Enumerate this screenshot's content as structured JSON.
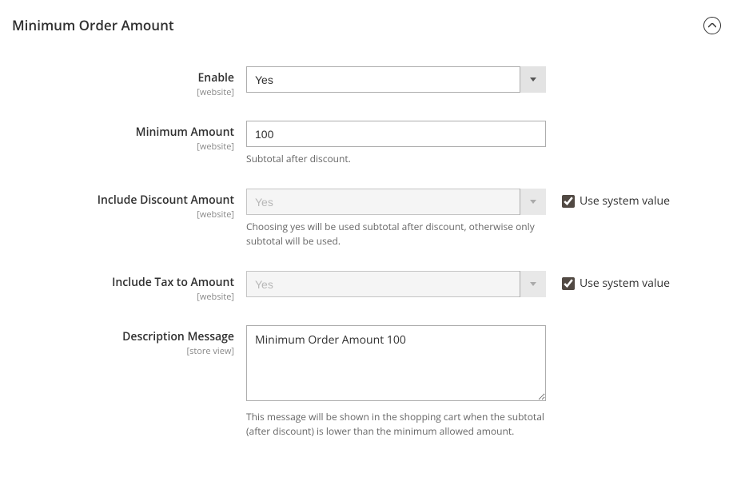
{
  "section": {
    "title": "Minimum Order Amount"
  },
  "fields": {
    "enable": {
      "label": "Enable",
      "scope": "[website]",
      "value": "Yes"
    },
    "minimum_amount": {
      "label": "Minimum Amount",
      "scope": "[website]",
      "value": "100",
      "help": "Subtotal after discount."
    },
    "include_discount": {
      "label": "Include Discount Amount",
      "scope": "[website]",
      "value": "Yes",
      "help": "Choosing yes will be used subtotal after discount, otherwise only subtotal will be used.",
      "use_system": true,
      "use_system_label": "Use system value"
    },
    "include_tax": {
      "label": "Include Tax to Amount",
      "scope": "[website]",
      "value": "Yes",
      "use_system": true,
      "use_system_label": "Use system value"
    },
    "description_message": {
      "label": "Description Message",
      "scope": "[store view]",
      "value": "Minimum Order Amount 100",
      "help": "This message will be shown in the shopping cart when the subtotal (after discount) is lower than the minimum allowed amount."
    }
  }
}
